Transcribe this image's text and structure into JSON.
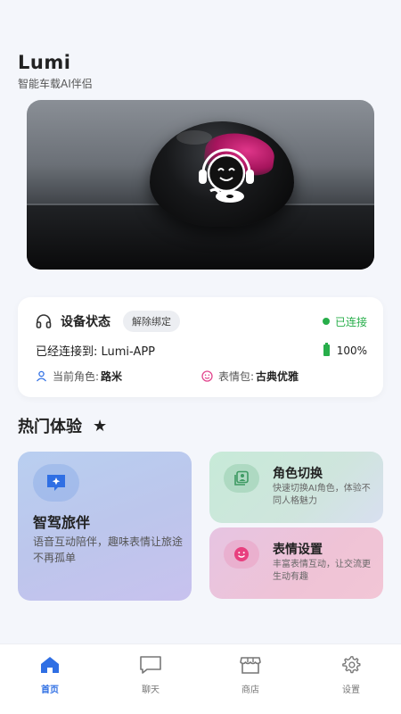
{
  "header": {
    "title": "Lumi",
    "subtitle": "智能车载AI伴侣"
  },
  "device": {
    "title": "设备状态",
    "unbind_label": "解除绑定",
    "status": "已连接",
    "connected_to": "已经连接到: Lumi-APP",
    "battery": "100%",
    "role_label": "当前角色:",
    "role_value": "路米",
    "emoji_label": "表情包:",
    "emoji_value": "古典优雅"
  },
  "hot": {
    "title": "热门体验",
    "cards": [
      {
        "title": "智驾旅伴",
        "desc": "语音互动陪伴，趣味表情让旅途不再孤单"
      },
      {
        "title": "角色切换",
        "desc": "快速切换AI角色，体验不同人格魅力"
      },
      {
        "title": "表情设置",
        "desc": "丰富表情互动，让交流更生动有趣"
      }
    ]
  },
  "tabs": [
    {
      "label": "首页"
    },
    {
      "label": "聊天"
    },
    {
      "label": "商店"
    },
    {
      "label": "设置"
    }
  ],
  "colors": {
    "accent": "#2f6fe4",
    "online": "#27ae4a",
    "star": "#f5b800",
    "orb_glow": "#d62b80"
  }
}
